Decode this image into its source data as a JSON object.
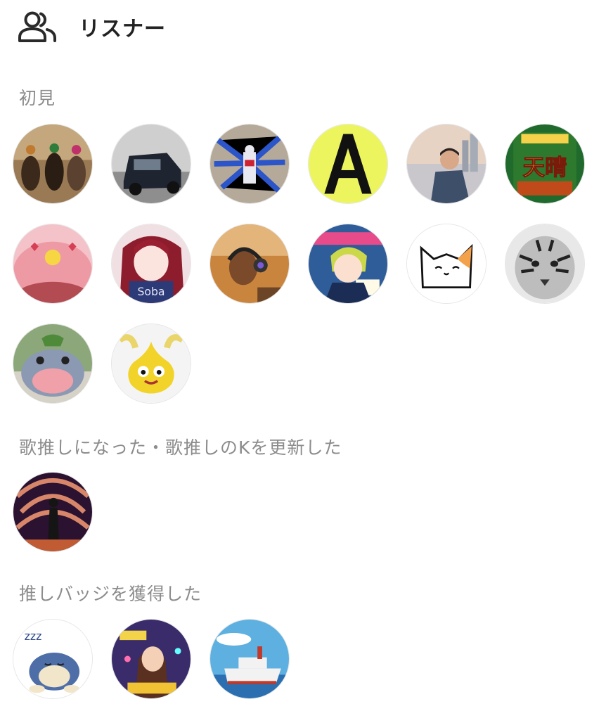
{
  "header": {
    "title": "リスナー",
    "icon": "users-icon"
  },
  "sections": [
    {
      "title": "初見",
      "avatars": [
        {
          "name": "avatar-horse-race",
          "scene": "horses"
        },
        {
          "name": "avatar-black-car",
          "scene": "car"
        },
        {
          "name": "avatar-gundam",
          "scene": "robot"
        },
        {
          "name": "avatar-letter-a",
          "scene": "letter",
          "text": "A"
        },
        {
          "name": "avatar-anime-man",
          "scene": "man"
        },
        {
          "name": "avatar-tensei-poster",
          "scene": "poster",
          "text": "天晴"
        },
        {
          "name": "avatar-pink-bird",
          "scene": "pinkbird"
        },
        {
          "name": "avatar-red-hair-girl",
          "scene": "girl",
          "text": "Soba"
        },
        {
          "name": "avatar-headphones-man",
          "scene": "headphones"
        },
        {
          "name": "avatar-anime-boy-poster",
          "scene": "animeboy"
        },
        {
          "name": "avatar-cat-drawing",
          "scene": "cat"
        },
        {
          "name": "avatar-tiger",
          "scene": "tiger"
        },
        {
          "name": "avatar-hippo",
          "scene": "hippo"
        },
        {
          "name": "avatar-golden-slime",
          "scene": "slime"
        }
      ]
    },
    {
      "title": "歌推しになった・歌推しのKを更新した",
      "avatars": [
        {
          "name": "avatar-stage-performer",
          "scene": "stage"
        }
      ]
    },
    {
      "title": "推しバッジを獲得した",
      "avatars": [
        {
          "name": "avatar-sleeping-creature",
          "scene": "sleepy"
        },
        {
          "name": "avatar-singer-poster",
          "scene": "singer"
        },
        {
          "name": "avatar-ship",
          "scene": "ship"
        }
      ]
    }
  ]
}
